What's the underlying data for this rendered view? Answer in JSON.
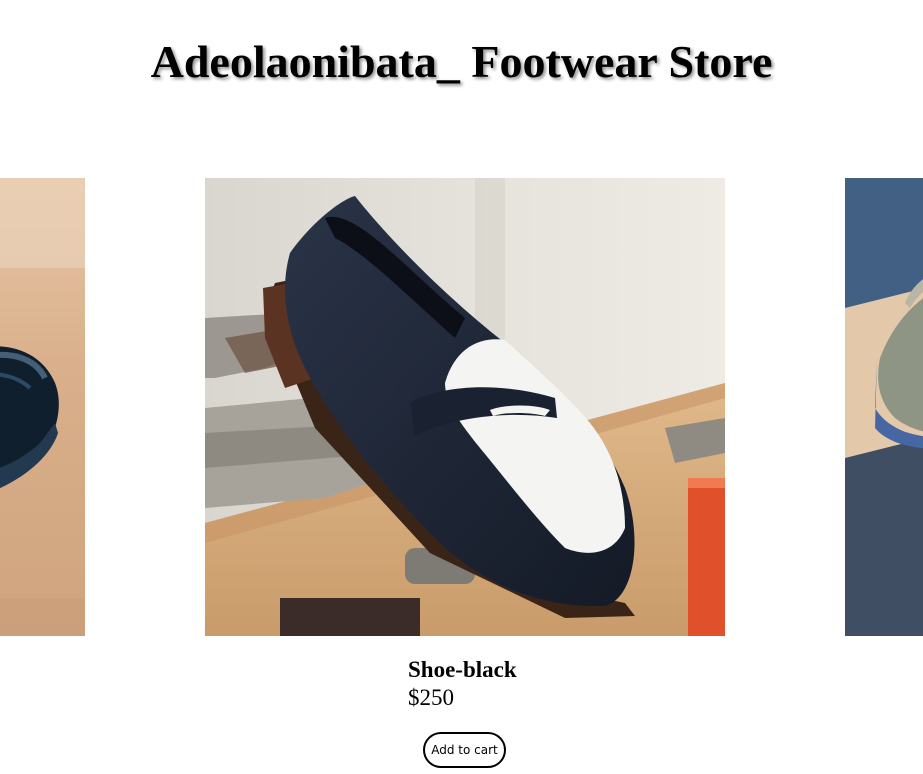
{
  "header": {
    "title": "Adeolaonibata_ Footwear Store"
  },
  "carousel": {
    "slides": [
      {
        "image": "shoe-photo-previous",
        "description_icon": "dark-leather-shoe-image"
      },
      {
        "image": "shoe-photo-current",
        "description_icon": "black-white-suede-loafer-image"
      },
      {
        "image": "shoe-photo-next",
        "description_icon": "grey-suede-shoe-image"
      }
    ]
  },
  "product": {
    "name": "Shoe-black",
    "price": "$250",
    "add_to_cart_label": "Add to cart"
  }
}
